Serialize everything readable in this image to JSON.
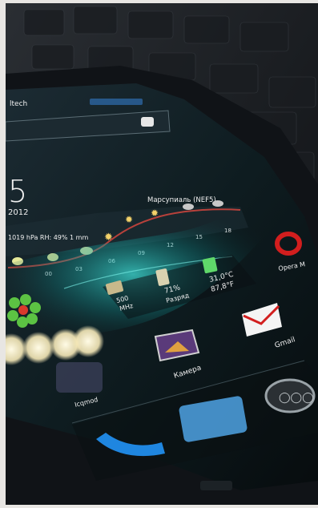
{
  "photo": {
    "status_bar": {
      "left_text": "ltech"
    },
    "clock": {
      "time": "5",
      "date": "2012"
    },
    "weather_widget": {
      "location": "Марсупиаль (NEF5)",
      "conditions": "1019 hPa  RH: 49%  1 mm",
      "hours": [
        "00",
        "03",
        "06",
        "09",
        "12",
        "15",
        "18"
      ]
    },
    "status_widget": {
      "cpu": "500",
      "cpu_unit": "MHz",
      "battery": "71%",
      "battery_label": "Разряд",
      "temp_c": "31,0°C",
      "temp_f": "87,8°F"
    },
    "apps": {
      "opera": "Opera M",
      "gmail": "Gmail",
      "camera": "Камера",
      "icq": "Icqm0",
      "icq_label": "Icqmod"
    },
    "colors": {
      "background": "#e8e6e3",
      "phone_body": "#111418",
      "screen": "#0b1a1c",
      "accent_cyan": "#2fd6d0",
      "curve_red": "#b7413b",
      "opera_red": "#d21e1e",
      "bokeh": "#fff6d2"
    }
  }
}
